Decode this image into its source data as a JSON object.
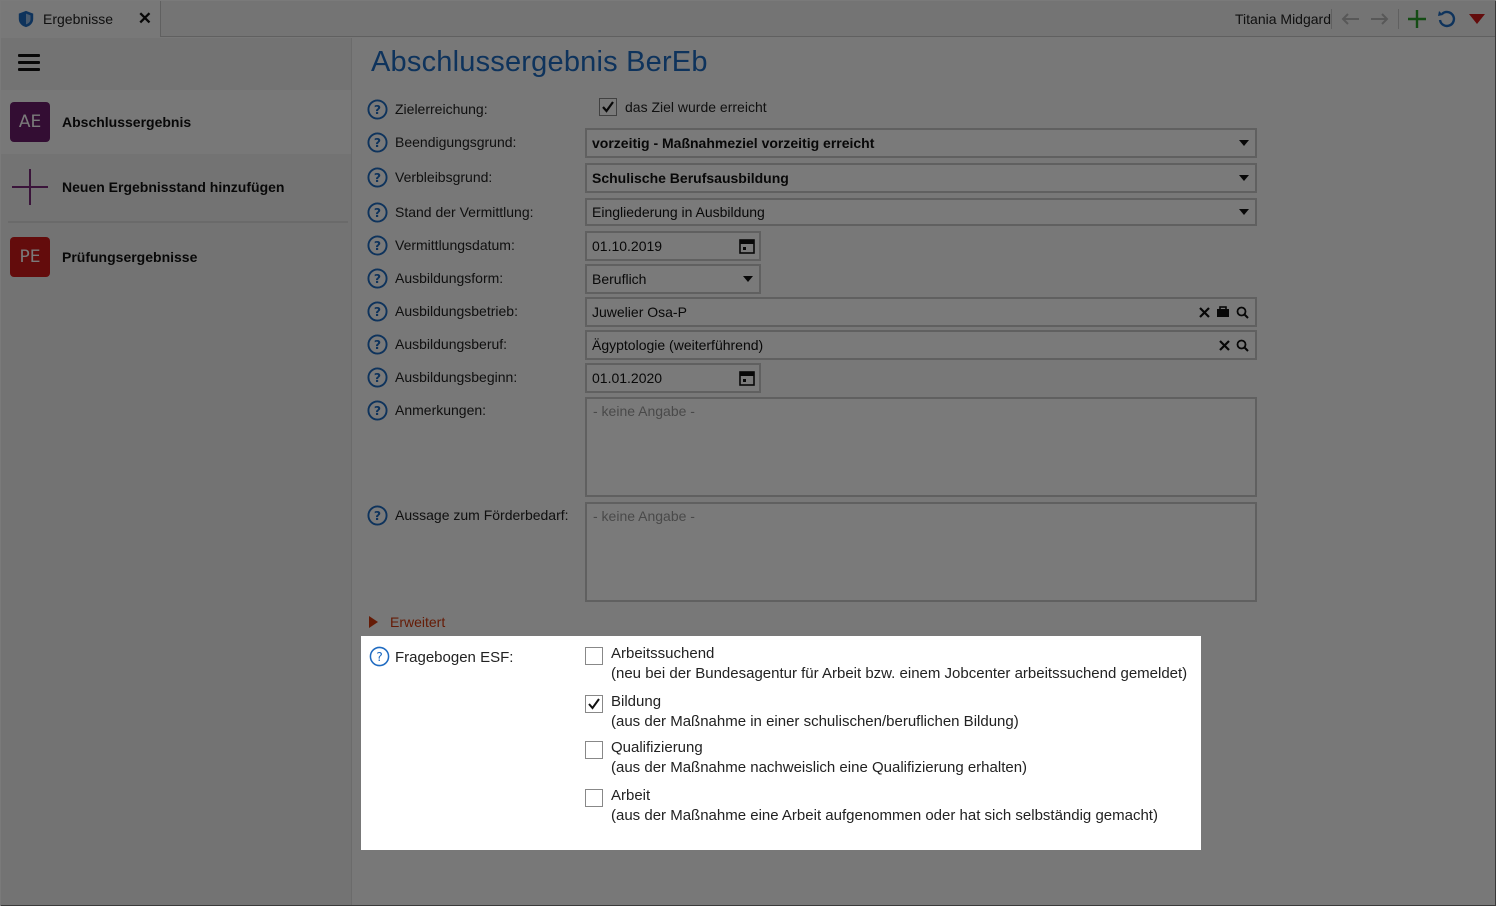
{
  "tab": {
    "label": "Ergebnisse",
    "close": "✕"
  },
  "header": {
    "user": "Titania Midgard"
  },
  "sidebar": {
    "items": [
      {
        "badge": "AE",
        "label": "Abschlussergebnis",
        "color": "#6b1d6b"
      },
      {
        "badge": "+",
        "label": "Neuen Ergebnisstand hinzufügen",
        "color": "#7a2a7a"
      },
      {
        "badge": "PE",
        "label": "Prüfungsergebnisse",
        "color": "#d01a1a"
      }
    ]
  },
  "main": {
    "title": "Abschlussergebnis BerEb",
    "fields": {
      "zielerreichung": {
        "label": "Zielerreichung:",
        "value": "das Ziel wurde erreicht",
        "checked": true
      },
      "beendigungsgrund": {
        "label": "Beendigungsgrund:",
        "value": "vorzeitig - Maßnahmeziel vorzeitig erreicht"
      },
      "verbleibsgrund": {
        "label": "Verbleibsgrund:",
        "value": "Schulische Berufsausbildung"
      },
      "stand": {
        "label": "Stand der Vermittlung:",
        "value": "Eingliederung in Ausbildung"
      },
      "vermittlungsdatum": {
        "label": "Vermittlungsdatum:",
        "value": "01.10.2019"
      },
      "ausbildungsform": {
        "label": "Ausbildungsform:",
        "value": "Beruflich"
      },
      "ausbildungsbetrieb": {
        "label": "Ausbildungsbetrieb:",
        "value": "Juwelier Osa-P"
      },
      "ausbildungsberuf": {
        "label": "Ausbildungsberuf:",
        "value": "Ägyptologie (weiterführend)"
      },
      "ausbildungsbeginn": {
        "label": "Ausbildungsbeginn:",
        "value": "01.01.2020"
      },
      "anmerkungen": {
        "label": "Anmerkungen:",
        "placeholder": "- keine Angabe -"
      },
      "foerderbedarf": {
        "label": "Aussage zum Förderbedarf:",
        "placeholder": "- keine Angabe -"
      }
    },
    "expander": {
      "label": "Erweitert"
    },
    "esf": {
      "label": "Fragebogen ESF:",
      "options": [
        {
          "title": "Arbeitssuchend",
          "desc": "(neu bei der Bundesagentur für Arbeit bzw. einem Jobcenter arbeitssuchend gemeldet)",
          "checked": false
        },
        {
          "title": "Bildung",
          "desc": "(aus der Maßnahme in einer schulischen/beruflichen Bildung)",
          "checked": true
        },
        {
          "title": "Qualifizierung",
          "desc": "(aus der Maßnahme nachweislich eine Qualifizierung erhalten)",
          "checked": false
        },
        {
          "title": "Arbeit",
          "desc": "(aus der Maßnahme eine Arbeit aufgenommen oder hat sich selbständig gemacht)",
          "checked": false
        }
      ]
    }
  },
  "colors": {
    "accent": "#1f6bc1",
    "expander": "#d43a0e",
    "add": "#2aa02a"
  }
}
